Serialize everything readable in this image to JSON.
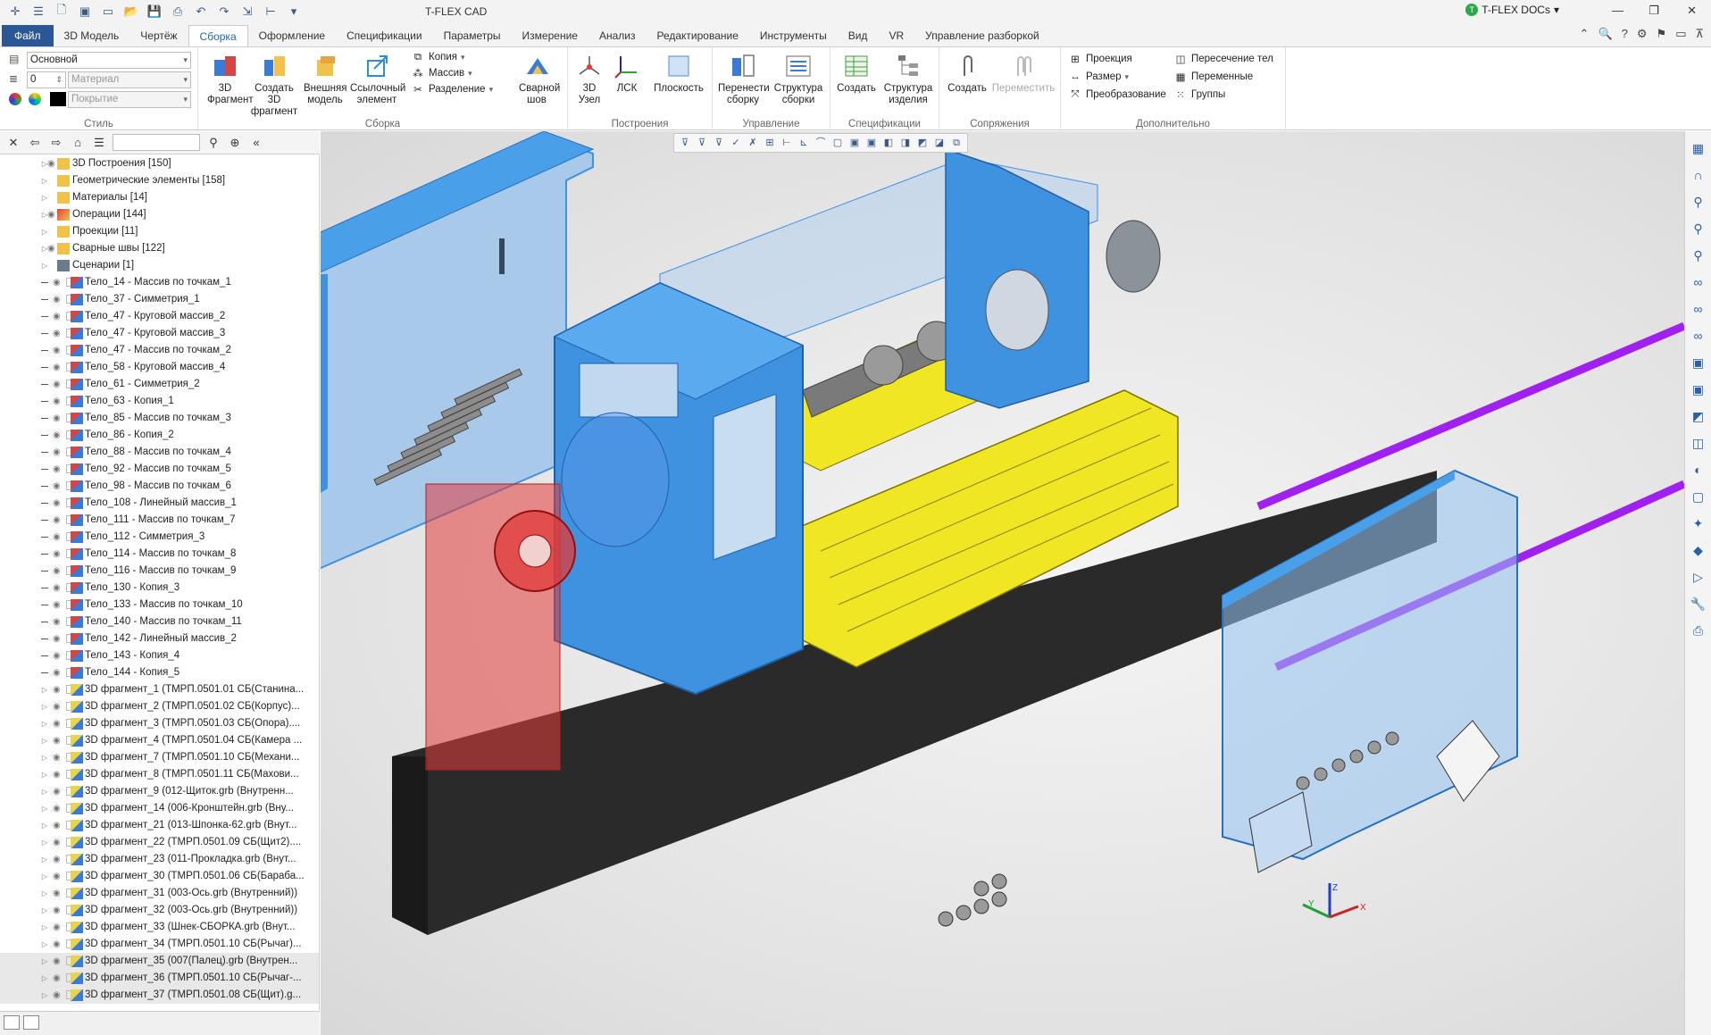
{
  "app_title": "T-FLEX CAD",
  "docs_button": "T-FLEX DOCs",
  "tabs": [
    "Файл",
    "3D Модель",
    "Чертёж",
    "Сборка",
    "Оформление",
    "Спецификации",
    "Параметры",
    "Измерение",
    "Анализ",
    "Редактирование",
    "Инструменты",
    "Вид",
    "VR",
    "Управление разборкой"
  ],
  "active_tab": "Сборка",
  "ribbon": {
    "style": {
      "label": "Стиль",
      "layer_value": "Основной",
      "number_value": "0",
      "material_placeholder": "Материал",
      "coating_placeholder": "Покрытие"
    },
    "assembly": {
      "label": "Сборка",
      "fragment": "3D Фрагмент",
      "create_fragment": "Создать 3D фрагмент",
      "external_model": "Внешняя модель",
      "ref_element": "Ссылочный элемент",
      "copy": "Копия",
      "array": "Массив",
      "split": "Разделение",
      "weld": "Сварной шов"
    },
    "constructions": {
      "label": "Построения",
      "node": "3D Узел",
      "lcs": "ЛСК",
      "plane": "Плоскость"
    },
    "management": {
      "label": "Управление",
      "move_assembly": "Перенести сборку",
      "assembly_structure": "Структура сборки"
    },
    "specifications": {
      "label": "Спецификации",
      "create": "Создать",
      "product_structure": "Структура изделия"
    },
    "mates": {
      "label": "Сопряжения",
      "create": "Создать",
      "move": "Переместить"
    },
    "additional": {
      "label": "Дополнительно",
      "projection": "Проекция",
      "size": "Размер",
      "transform": "Преобразование",
      "body_intersection": "Пересечение тел",
      "variables": "Переменные",
      "groups": "Группы"
    }
  },
  "tree": [
    {
      "label": "3D Построения [150]",
      "type": "folder",
      "level": 0
    },
    {
      "label": "Геометрические элементы [158]",
      "type": "folder",
      "level": 0
    },
    {
      "label": "Материалы [14]",
      "type": "folder",
      "level": 0
    },
    {
      "label": "Операции [144]",
      "type": "ops",
      "level": 0
    },
    {
      "label": "Проекции [11]",
      "type": "folder",
      "level": 0
    },
    {
      "label": "Сварные швы [122]",
      "type": "folder",
      "level": 0
    },
    {
      "label": "Сценарии [1]",
      "type": "scen",
      "level": 0
    },
    {
      "label": "Тело_14 - Массив по точкам_1",
      "type": "body",
      "level": 1
    },
    {
      "label": "Тело_37 - Симметрия_1",
      "type": "body",
      "level": 1
    },
    {
      "label": "Тело_47 - Круговой массив_2",
      "type": "body",
      "level": 1
    },
    {
      "label": "Тело_47 - Круговой массив_3",
      "type": "body",
      "level": 1
    },
    {
      "label": "Тело_47 - Массив по точкам_2",
      "type": "body",
      "level": 1
    },
    {
      "label": "Тело_58 - Круговой массив_4",
      "type": "body",
      "level": 1
    },
    {
      "label": "Тело_61 - Симметрия_2",
      "type": "body",
      "level": 1
    },
    {
      "label": "Тело_63 - Копия_1",
      "type": "body",
      "level": 1
    },
    {
      "label": "Тело_85 - Массив по точкам_3",
      "type": "body",
      "level": 1
    },
    {
      "label": "Тело_86 - Копия_2",
      "type": "body",
      "level": 1
    },
    {
      "label": "Тело_88 - Массив по точкам_4",
      "type": "body",
      "level": 1
    },
    {
      "label": "Тело_92 - Массив по точкам_5",
      "type": "body",
      "level": 1
    },
    {
      "label": "Тело_98 - Массив по точкам_6",
      "type": "body",
      "level": 1
    },
    {
      "label": "Тело_108 - Линейный массив_1",
      "type": "body",
      "level": 1
    },
    {
      "label": "Тело_111 - Массив по точкам_7",
      "type": "body",
      "level": 1
    },
    {
      "label": "Тело_112 - Симметрия_3",
      "type": "body",
      "level": 1
    },
    {
      "label": "Тело_114 - Массив по точкам_8",
      "type": "body",
      "level": 1
    },
    {
      "label": "Тело_116 - Массив по точкам_9",
      "type": "body",
      "level": 1
    },
    {
      "label": "Тело_130 - Копия_3",
      "type": "body",
      "level": 1
    },
    {
      "label": "Тело_133 - Массив по точкам_10",
      "type": "body",
      "level": 1
    },
    {
      "label": "Тело_140 - Массив по точкам_11",
      "type": "body",
      "level": 1
    },
    {
      "label": "Тело_142 - Линейный массив_2",
      "type": "body",
      "level": 1
    },
    {
      "label": "Тело_143 - Копия_4",
      "type": "body",
      "level": 1
    },
    {
      "label": "Тело_144 - Копия_5",
      "type": "body",
      "level": 1
    },
    {
      "label": "3D фрагмент_1 (ТМРП.0501.01 СБ(Станина...",
      "type": "frag",
      "level": 1
    },
    {
      "label": "3D фрагмент_2 (ТМРП.0501.02 СБ(Корпус)...",
      "type": "frag",
      "level": 1
    },
    {
      "label": "3D фрагмент_3 (ТМРП.0501.03 СБ(Опора)....",
      "type": "frag",
      "level": 1
    },
    {
      "label": "3D фрагмент_4 (ТМРП.0501.04 СБ(Камера ...",
      "type": "frag",
      "level": 1
    },
    {
      "label": "3D фрагмент_7 (ТМРП.0501.10 СБ(Механи...",
      "type": "frag",
      "level": 1
    },
    {
      "label": "3D фрагмент_8 (ТМРП.0501.11 СБ(Махови...",
      "type": "frag",
      "level": 1
    },
    {
      "label": "3D фрагмент_9 (012-Щиток.grb (Внутренн...",
      "type": "frag",
      "level": 1
    },
    {
      "label": "3D фрагмент_14 (006-Кронштейн.grb (Вну...",
      "type": "frag",
      "level": 1
    },
    {
      "label": "3D фрагмент_21 (013-Шпонка-62.grb (Внут...",
      "type": "frag",
      "level": 1
    },
    {
      "label": "3D фрагмент_22 (ТМРП.0501.09 СБ(Щит2)....",
      "type": "frag",
      "level": 1
    },
    {
      "label": "3D фрагмент_23 (011-Прокладка.grb (Внут...",
      "type": "frag",
      "level": 1
    },
    {
      "label": "3D фрагмент_30 (ТМРП.0501.06 СБ(Бараба...",
      "type": "frag",
      "level": 1
    },
    {
      "label": "3D фрагмент_31 (003-Ось.grb (Внутренний))",
      "type": "frag",
      "level": 1
    },
    {
      "label": "3D фрагмент_32 (003-Ось.grb (Внутренний))",
      "type": "frag",
      "level": 1
    },
    {
      "label": "3D фрагмент_33 (Шнек-СБОРКА.grb (Внут...",
      "type": "frag",
      "level": 1
    },
    {
      "label": "3D фрагмент_34 (ТМРП.0501.10 СБ(Рычаг)...",
      "type": "frag",
      "level": 1
    },
    {
      "label": "3D фрагмент_35 (007(Палец).grb (Внутрен...",
      "type": "frag",
      "level": 1
    },
    {
      "label": "3D фрагмент_36 (ТМРП.0501.10 СБ(Рычаг-...",
      "type": "frag",
      "level": 1
    },
    {
      "label": "3D фрагмент_37 (ТМРП.0501.08 СБ(Щит).g...",
      "type": "frag",
      "level": 1
    }
  ],
  "axis_labels": {
    "x": "X",
    "y": "Y",
    "z": "Z"
  },
  "colors": {
    "file_tab": "#2b5797",
    "frame_blue": "#3f92e0",
    "rotor_yellow": "#f0e623",
    "flange_red": "#e23a3a",
    "base_black": "#2a2a2a",
    "shaft_purple": "#a020f0"
  }
}
